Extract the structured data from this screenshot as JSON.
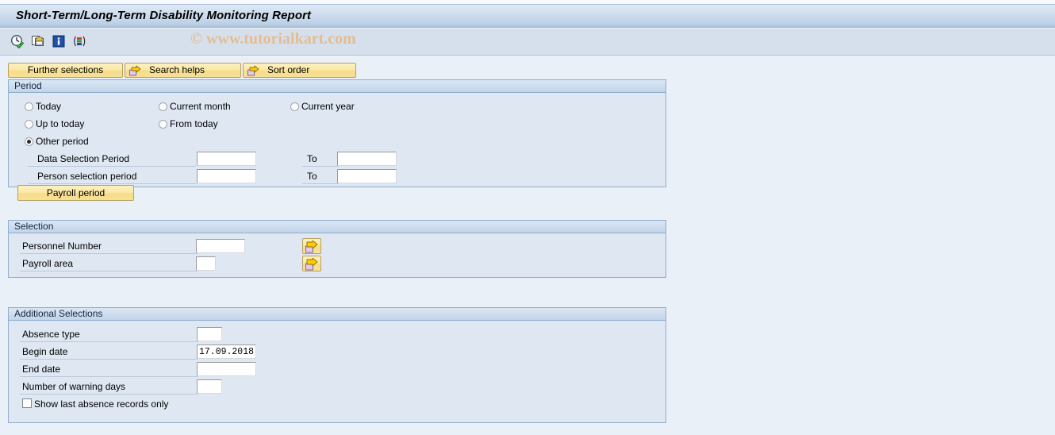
{
  "window": {
    "title": "Short-Term/Long-Term Disability Monitoring Report"
  },
  "watermark": {
    "text": "© www.tutorialkart.com"
  },
  "toolbar": {
    "icons": [
      {
        "name": "execute-icon",
        "title": "Execute"
      },
      {
        "name": "copy-variant-icon",
        "title": "Get Variant"
      },
      {
        "name": "info-icon",
        "title": "Information"
      },
      {
        "name": "layout-icon",
        "title": "Choose Layout"
      }
    ]
  },
  "pushbuttons": {
    "further_selections": "Further selections",
    "search_helps": "Search helps",
    "sort_order": "Sort order",
    "payroll_period": "Payroll period"
  },
  "period": {
    "title": "Period",
    "radios": [
      {
        "label": "Today",
        "checked": false
      },
      {
        "label": "Current month",
        "checked": false
      },
      {
        "label": "Current year",
        "checked": false
      },
      {
        "label": "Up to today",
        "checked": false
      },
      {
        "label": "From today",
        "checked": false
      },
      {
        "label": "Other period",
        "checked": true
      }
    ],
    "rows": [
      {
        "label": "Data Selection Period",
        "from_value": "",
        "to_label": "To",
        "to_value": ""
      },
      {
        "label": "Person selection period",
        "from_value": "",
        "to_label": "To",
        "to_value": ""
      }
    ]
  },
  "selection": {
    "title": "Selection",
    "rows": [
      {
        "label": "Personnel Number",
        "value": "",
        "has_multi": true
      },
      {
        "label": "Payroll area",
        "value": "",
        "has_multi": true
      }
    ]
  },
  "additional": {
    "title": "Additional Selections",
    "rows": [
      {
        "label": "Absence type",
        "value": ""
      },
      {
        "label": "Begin date",
        "value": "17.09.2018"
      },
      {
        "label": "End date",
        "value": ""
      },
      {
        "label": "Number of warning days",
        "value": ""
      }
    ],
    "checkbox": {
      "label": "Show last absence records only",
      "checked": false
    }
  },
  "colors": {
    "page_bg": "#eaf0f8",
    "titlebar_from": "#dde8f4",
    "titlebar_to": "#adc5de",
    "groupbox_bg": "#dfe8f2",
    "button_yellow": "#fbe9a6",
    "watermark": "#e6bc92"
  }
}
